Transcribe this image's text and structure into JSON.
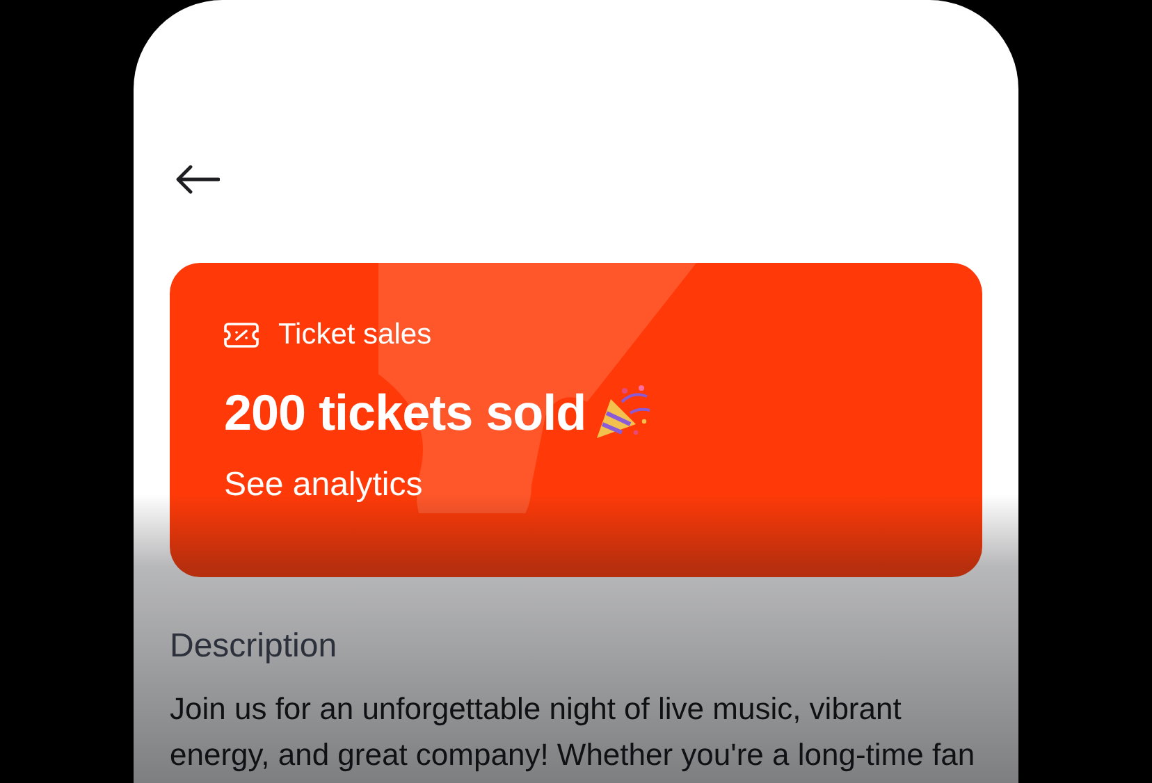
{
  "card": {
    "label": "Ticket sales",
    "headline": "200 tickets sold",
    "link": "See analytics"
  },
  "description": {
    "heading": "Description",
    "text": "Join us for an unforgettable night of live music, vibrant energy, and great company! Whether you're a long-time fan"
  }
}
